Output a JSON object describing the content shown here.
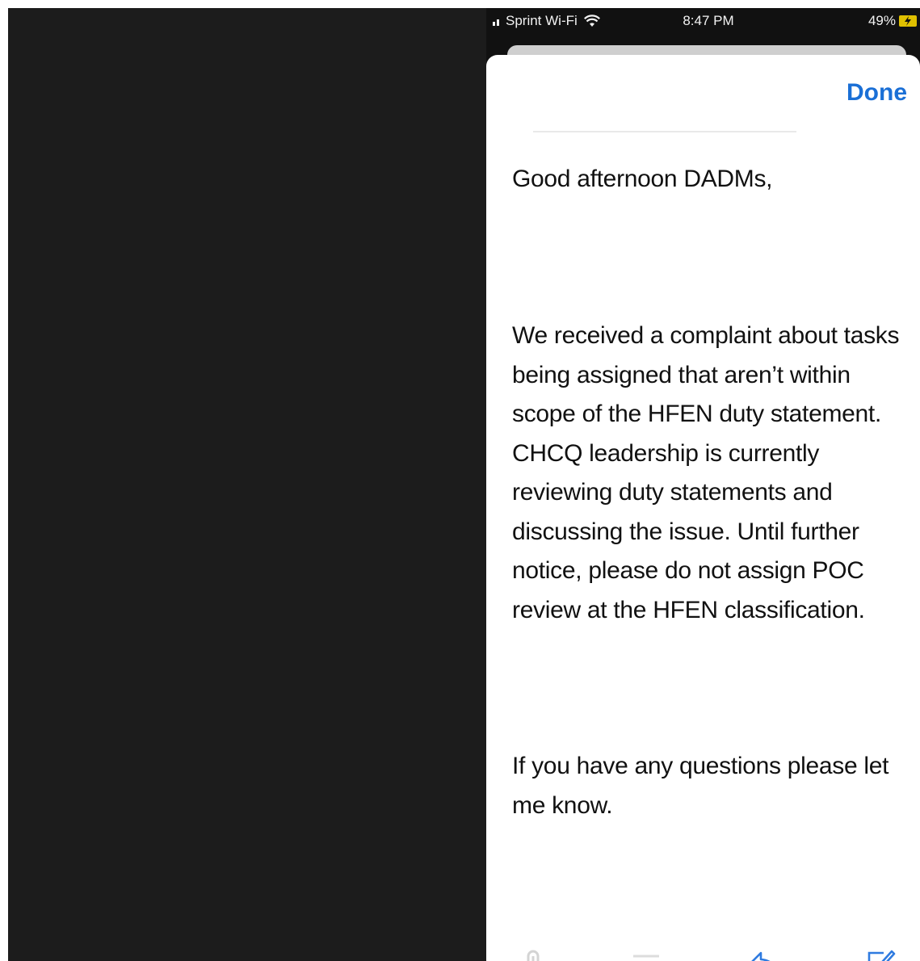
{
  "status_bar": {
    "carrier": "Sprint Wi-Fi",
    "time": "8:47 PM",
    "battery": "49%"
  },
  "sheet": {
    "done_label": "Done"
  },
  "message": {
    "greeting": "Good afternoon DADMs,",
    "paragraph1": "We received a complaint about tasks being assigned that aren’t within scope of the HFEN duty statement. CHCQ leadership is currently reviewing duty statements and discussing the issue.  Until further notice, please do not assign POC review at the HFEN classification.",
    "paragraph2": "If you have any questions please let me know."
  },
  "toolbar": {
    "icons": [
      "attachment-icon",
      "format-icon",
      "reply-icon",
      "compose-icon"
    ],
    "accent_color": "#1a6fd6"
  }
}
